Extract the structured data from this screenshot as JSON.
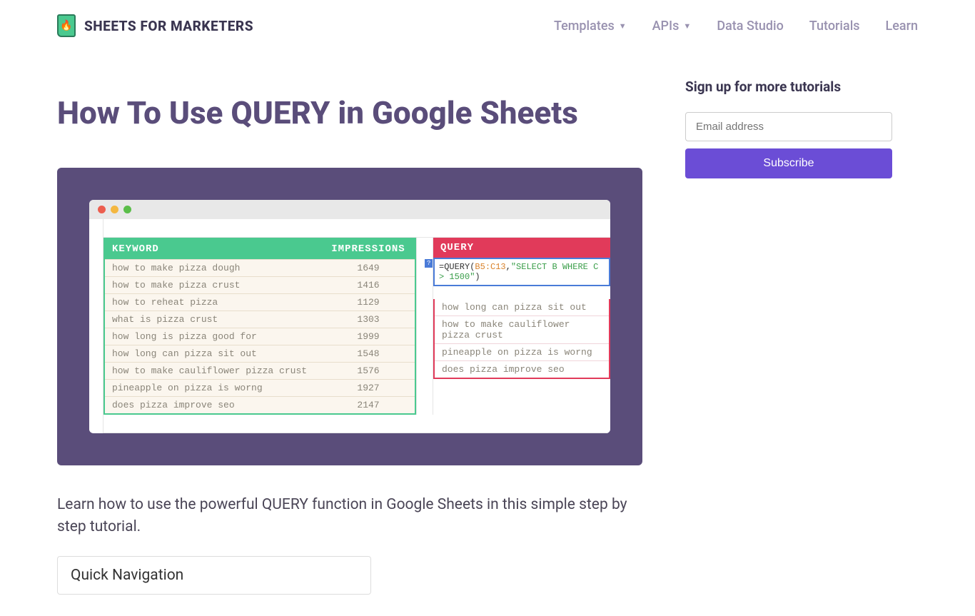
{
  "header": {
    "brand": "SHEETS FOR MARKETERS",
    "nav": [
      "Templates",
      "APIs",
      "Data Studio",
      "Tutorials",
      "Learn"
    ]
  },
  "page": {
    "title": "How To Use QUERY in Google Sheets",
    "description": "Learn how to use the powerful QUERY function in Google Sheets in this simple step by step tutorial.",
    "quicknav": "Quick Navigation"
  },
  "hero": {
    "left": {
      "headers": {
        "keyword": "KEYWORD",
        "impressions": "IMPRESSIONS"
      },
      "rows": [
        {
          "kw": "how to make pizza dough",
          "imp": "1649"
        },
        {
          "kw": "how to make pizza crust",
          "imp": "1416"
        },
        {
          "kw": "how to reheat pizza",
          "imp": "1129"
        },
        {
          "kw": "what is pizza crust",
          "imp": "1303"
        },
        {
          "kw": "how long is pizza good for",
          "imp": "1999"
        },
        {
          "kw": "how long can pizza sit out",
          "imp": "1548"
        },
        {
          "kw": "how to make cauliflower pizza crust",
          "imp": "1576"
        },
        {
          "kw": "pineapple on pizza is worng",
          "imp": "1927"
        },
        {
          "kw": "does pizza improve seo",
          "imp": "2147"
        }
      ]
    },
    "right": {
      "header": "QUERY",
      "formula": {
        "fn": "=QUERY(",
        "range": "B5:C13",
        "comma": ",",
        "str": "\"SELECT B WHERE C > 1500\"",
        "close": ")"
      },
      "results": [
        "how long can pizza sit out",
        "how to make cauliflower pizza crust",
        "pineapple on pizza is worng",
        "does pizza improve seo"
      ]
    }
  },
  "sidebar": {
    "title": "Sign up for more tutorials",
    "placeholder": "Email address",
    "button": "Subscribe"
  }
}
